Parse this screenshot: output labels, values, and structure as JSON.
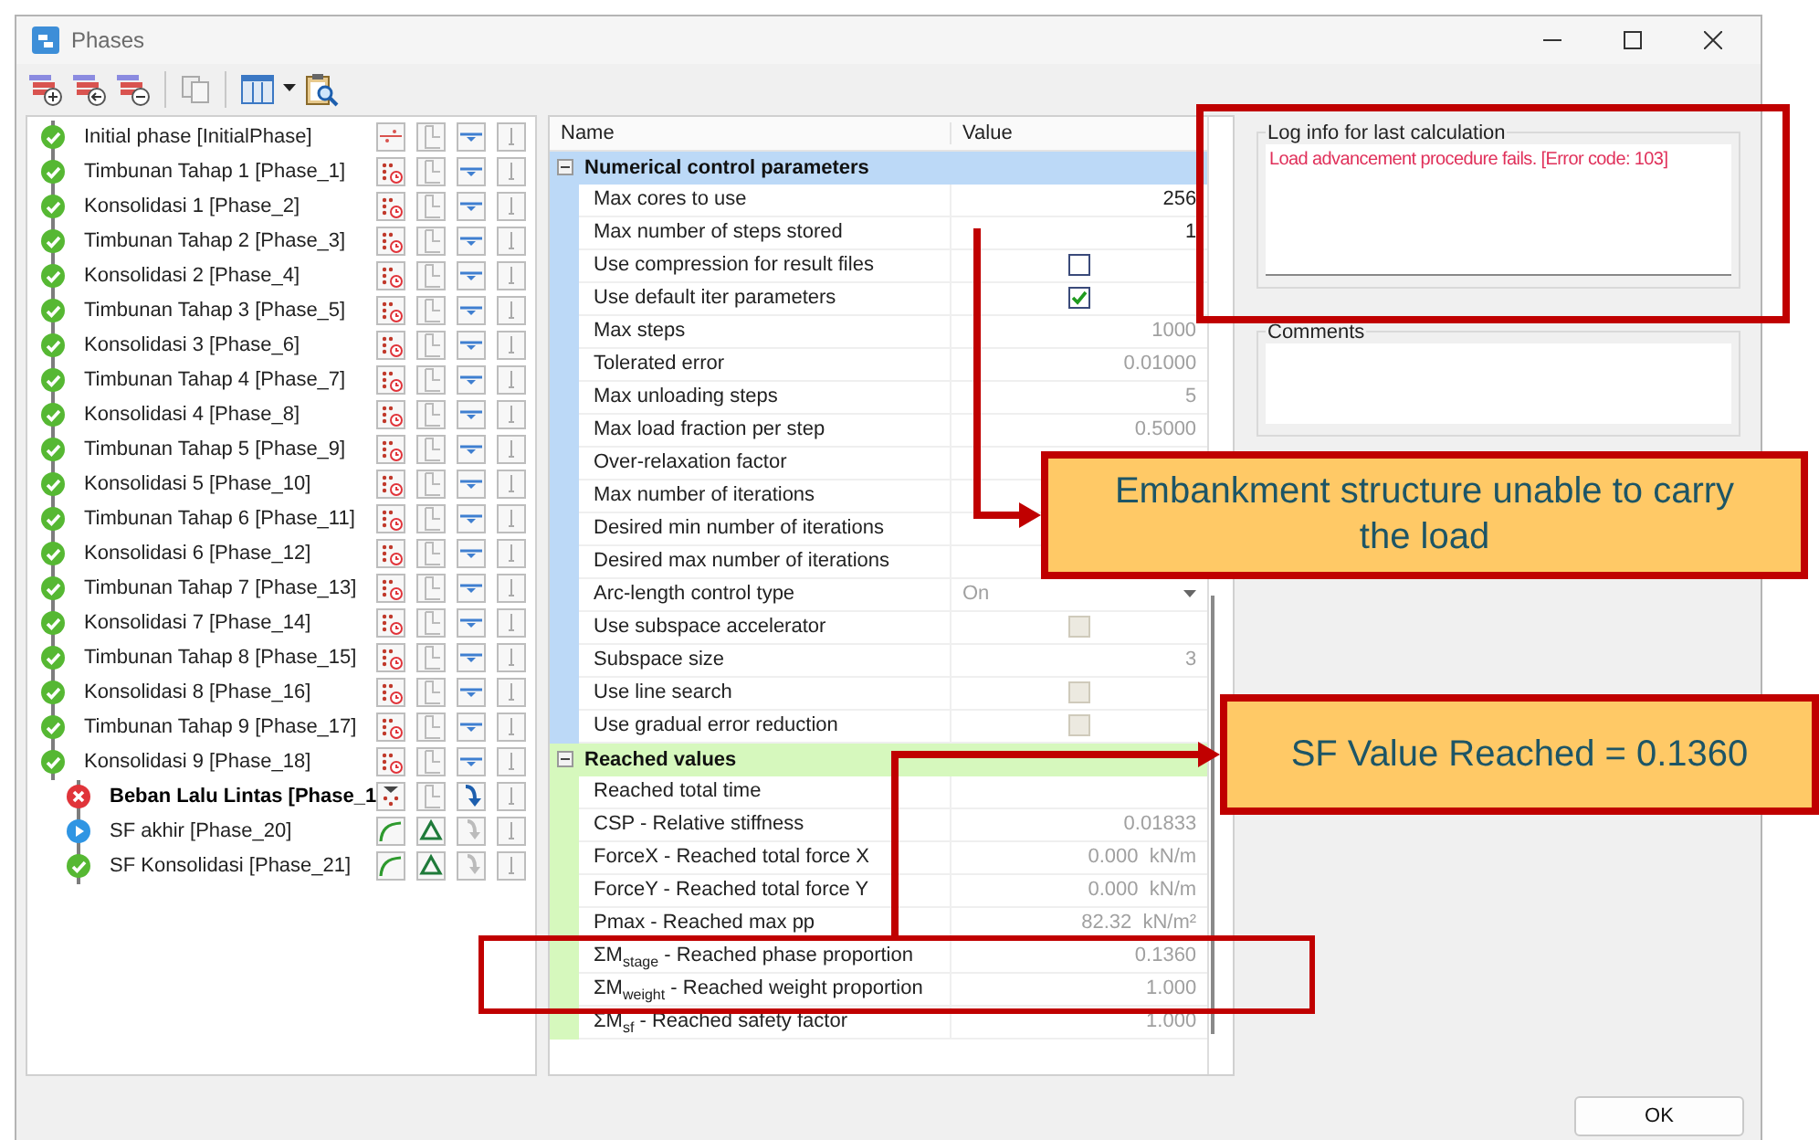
{
  "window": {
    "title": "Phases"
  },
  "phases": [
    {
      "label": "Initial phase [InitialPhase]",
      "kind": "ok",
      "selected": false,
      "icons": [
        {
          "kind": "initial"
        },
        {
          "kind": "staged"
        },
        {
          "kind": "phreatic"
        },
        {
          "kind": "bar"
        }
      ]
    },
    {
      "label": "Timbunan Tahap 1 [Phase_1]",
      "kind": "ok",
      "selected": false,
      "icons": [
        {
          "kind": "consolidation"
        },
        {
          "kind": "staged"
        },
        {
          "kind": "phreatic"
        },
        {
          "kind": "bar"
        }
      ]
    },
    {
      "label": "Konsolidasi 1 [Phase_2]",
      "kind": "ok",
      "selected": false,
      "icons": [
        {
          "kind": "consolidation"
        },
        {
          "kind": "staged"
        },
        {
          "kind": "phreatic"
        },
        {
          "kind": "bar"
        }
      ]
    },
    {
      "label": "Timbunan Tahap 2 [Phase_3]",
      "kind": "ok",
      "selected": false,
      "icons": [
        {
          "kind": "consolidation"
        },
        {
          "kind": "staged"
        },
        {
          "kind": "phreatic"
        },
        {
          "kind": "bar"
        }
      ]
    },
    {
      "label": "Konsolidasi 2 [Phase_4]",
      "kind": "ok",
      "selected": false,
      "icons": [
        {
          "kind": "consolidation"
        },
        {
          "kind": "staged"
        },
        {
          "kind": "phreatic"
        },
        {
          "kind": "bar"
        }
      ]
    },
    {
      "label": "Timbunan Tahap 3 [Phase_5]",
      "kind": "ok",
      "selected": false,
      "icons": [
        {
          "kind": "consolidation"
        },
        {
          "kind": "staged"
        },
        {
          "kind": "phreatic"
        },
        {
          "kind": "bar"
        }
      ]
    },
    {
      "label": "Konsolidasi 3 [Phase_6]",
      "kind": "ok",
      "selected": false,
      "icons": [
        {
          "kind": "consolidation"
        },
        {
          "kind": "staged"
        },
        {
          "kind": "phreatic"
        },
        {
          "kind": "bar"
        }
      ]
    },
    {
      "label": "Timbunan Tahap 4 [Phase_7]",
      "kind": "ok",
      "selected": false,
      "icons": [
        {
          "kind": "consolidation"
        },
        {
          "kind": "staged"
        },
        {
          "kind": "phreatic"
        },
        {
          "kind": "bar"
        }
      ]
    },
    {
      "label": "Konsolidasi 4 [Phase_8]",
      "kind": "ok",
      "selected": false,
      "icons": [
        {
          "kind": "consolidation"
        },
        {
          "kind": "staged"
        },
        {
          "kind": "phreatic"
        },
        {
          "kind": "bar"
        }
      ]
    },
    {
      "label": "Timbunan Tahap 5 [Phase_9]",
      "kind": "ok",
      "selected": false,
      "icons": [
        {
          "kind": "consolidation"
        },
        {
          "kind": "staged"
        },
        {
          "kind": "phreatic"
        },
        {
          "kind": "bar"
        }
      ]
    },
    {
      "label": "Konsolidasi 5 [Phase_10]",
      "kind": "ok",
      "selected": false,
      "icons": [
        {
          "kind": "consolidation"
        },
        {
          "kind": "staged"
        },
        {
          "kind": "phreatic"
        },
        {
          "kind": "bar"
        }
      ]
    },
    {
      "label": "Timbunan Tahap 6 [Phase_11]",
      "kind": "ok",
      "selected": false,
      "icons": [
        {
          "kind": "consolidation"
        },
        {
          "kind": "staged"
        },
        {
          "kind": "phreatic"
        },
        {
          "kind": "bar"
        }
      ]
    },
    {
      "label": "Konsolidasi 6 [Phase_12]",
      "kind": "ok",
      "selected": false,
      "icons": [
        {
          "kind": "consolidation"
        },
        {
          "kind": "staged"
        },
        {
          "kind": "phreatic"
        },
        {
          "kind": "bar"
        }
      ]
    },
    {
      "label": "Timbunan Tahap 7 [Phase_13]",
      "kind": "ok",
      "selected": false,
      "icons": [
        {
          "kind": "consolidation"
        },
        {
          "kind": "staged"
        },
        {
          "kind": "phreatic"
        },
        {
          "kind": "bar"
        }
      ]
    },
    {
      "label": "Konsolidasi 7 [Phase_14]",
      "kind": "ok",
      "selected": false,
      "icons": [
        {
          "kind": "consolidation"
        },
        {
          "kind": "staged"
        },
        {
          "kind": "phreatic"
        },
        {
          "kind": "bar"
        }
      ]
    },
    {
      "label": "Timbunan Tahap 8 [Phase_15]",
      "kind": "ok",
      "selected": false,
      "icons": [
        {
          "kind": "consolidation"
        },
        {
          "kind": "staged"
        },
        {
          "kind": "phreatic"
        },
        {
          "kind": "bar"
        }
      ]
    },
    {
      "label": "Konsolidasi 8 [Phase_16]",
      "kind": "ok",
      "selected": false,
      "icons": [
        {
          "kind": "consolidation"
        },
        {
          "kind": "staged"
        },
        {
          "kind": "phreatic"
        },
        {
          "kind": "bar"
        }
      ]
    },
    {
      "label": "Timbunan Tahap 9 [Phase_17]",
      "kind": "ok",
      "selected": false,
      "icons": [
        {
          "kind": "consolidation"
        },
        {
          "kind": "staged"
        },
        {
          "kind": "phreatic"
        },
        {
          "kind": "bar"
        }
      ]
    },
    {
      "label": "Konsolidasi 9 [Phase_18]",
      "kind": "ok",
      "selected": false,
      "icons": [
        {
          "kind": "consolidation"
        },
        {
          "kind": "staged"
        },
        {
          "kind": "phreatic"
        },
        {
          "kind": "bar"
        }
      ],
      "children": [
        {
          "label": "Beban Lalu Lintas [Phase_1",
          "kind": "failed",
          "selected": true,
          "icons": [
            {
              "kind": "plastic"
            },
            {
              "kind": "staged"
            },
            {
              "kind": "from_previous"
            },
            {
              "kind": "bar"
            }
          ]
        },
        {
          "label": "SF akhir [Phase_20]",
          "kind": "pending",
          "selected": false,
          "icons": [
            {
              "kind": "safety"
            },
            {
              "kind": "sum_msf"
            },
            {
              "kind": "inactive"
            },
            {
              "kind": "bar"
            }
          ]
        },
        {
          "label": "SF Konsolidasi [Phase_21]",
          "kind": "ok",
          "selected": false,
          "icons": [
            {
              "kind": "safety"
            },
            {
              "kind": "sum_msf"
            },
            {
              "kind": "inactive"
            },
            {
              "kind": "bar"
            }
          ]
        }
      ]
    }
  ],
  "grid": {
    "columns": [
      "Name",
      "Value"
    ],
    "groups": [
      {
        "label": "Numerical control parameters",
        "expanded": true,
        "color": "#bcd9f7",
        "rows": [
          {
            "kind": "number",
            "label": "Max cores to use",
            "value": "256",
            "disabled": false
          },
          {
            "kind": "number",
            "label": "Max number of steps stored",
            "value": "1",
            "disabled": false
          },
          {
            "kind": "checkbox",
            "label": "Use compression for result files",
            "checked": false,
            "disabled": false
          },
          {
            "kind": "checkbox",
            "label": "Use default iter parameters",
            "checked": true,
            "disabled": false
          },
          {
            "kind": "number",
            "label": "Max steps",
            "value": "1000",
            "disabled": true
          },
          {
            "kind": "number",
            "label": "Tolerated error",
            "value": "0.01000",
            "disabled": true
          },
          {
            "kind": "number",
            "label": "Max unloading steps",
            "value": "5",
            "disabled": true
          },
          {
            "kind": "number",
            "label": "Max load fraction per step",
            "value": "0.5000",
            "disabled": true
          },
          {
            "kind": "number",
            "label": "Over-relaxation factor"
          },
          {
            "kind": "number",
            "label": "Max number of iterations"
          },
          {
            "kind": "number",
            "label": "Desired min number of iterations"
          },
          {
            "kind": "number",
            "label": "Desired max number of iterations"
          },
          {
            "kind": "dropdown",
            "label": "Arc-length control type",
            "value": "On",
            "disabled": true
          },
          {
            "kind": "checkbox",
            "label": "Use subspace accelerator",
            "checked": false,
            "disabled": true
          },
          {
            "kind": "number",
            "label": "Subspace size",
            "value": "3",
            "disabled": true
          },
          {
            "kind": "checkbox",
            "label": "Use line search",
            "checked": false,
            "disabled": true
          },
          {
            "kind": "checkbox",
            "label": "Use gradual error reduction",
            "checked": false,
            "disabled": true
          }
        ]
      },
      {
        "label": "Reached values",
        "expanded": true,
        "color": "#d6f8bd",
        "rows": [
          {
            "kind": "number",
            "label": "Reached total time"
          },
          {
            "kind": "number",
            "label": "CSP - Relative stiffness",
            "value": "0.01833",
            "disabled": true
          },
          {
            "kind": "number",
            "label": "ForceX - Reached total force X",
            "value": "0.000  kN/m",
            "disabled": true
          },
          {
            "kind": "number",
            "label": "ForceY - Reached total force Y",
            "value": "0.000  kN/m",
            "disabled": true
          },
          {
            "kind": "number",
            "label": "Pmax - Reached max pp",
            "value": "82.32  kN/m²",
            "disabled": true
          },
          {
            "kind": "number",
            "label": "ΣM$_{stage}$ - Reached phase proportion",
            "value": "0.1360",
            "disabled": true
          },
          {
            "kind": "number",
            "label": "ΣM$_{weight}$ - Reached weight proportion",
            "value": "1.000",
            "disabled": true
          },
          {
            "kind": "number",
            "label": "ΣM$_{sf}$ - Reached safety factor",
            "value": "1.000",
            "disabled": true
          }
        ]
      }
    ]
  },
  "log": {
    "title": "Log info for last calculation",
    "messages": [
      {
        "text": "Load advancement procedure fails. [Error code: 103]",
        "kind": "error"
      }
    ]
  },
  "comments": {
    "title": "Comments"
  },
  "footer": {
    "button": "OK"
  },
  "annotations": [
    {
      "kind": "frame"
    },
    {
      "kind": "callout",
      "text": "Embankment structure unable to carry the load"
    },
    {
      "kind": "arrow"
    },
    {
      "kind": "callout",
      "text": "SF Value Reached = 0.1360"
    },
    {
      "kind": "arrow"
    },
    {
      "kind": "frame"
    }
  ]
}
